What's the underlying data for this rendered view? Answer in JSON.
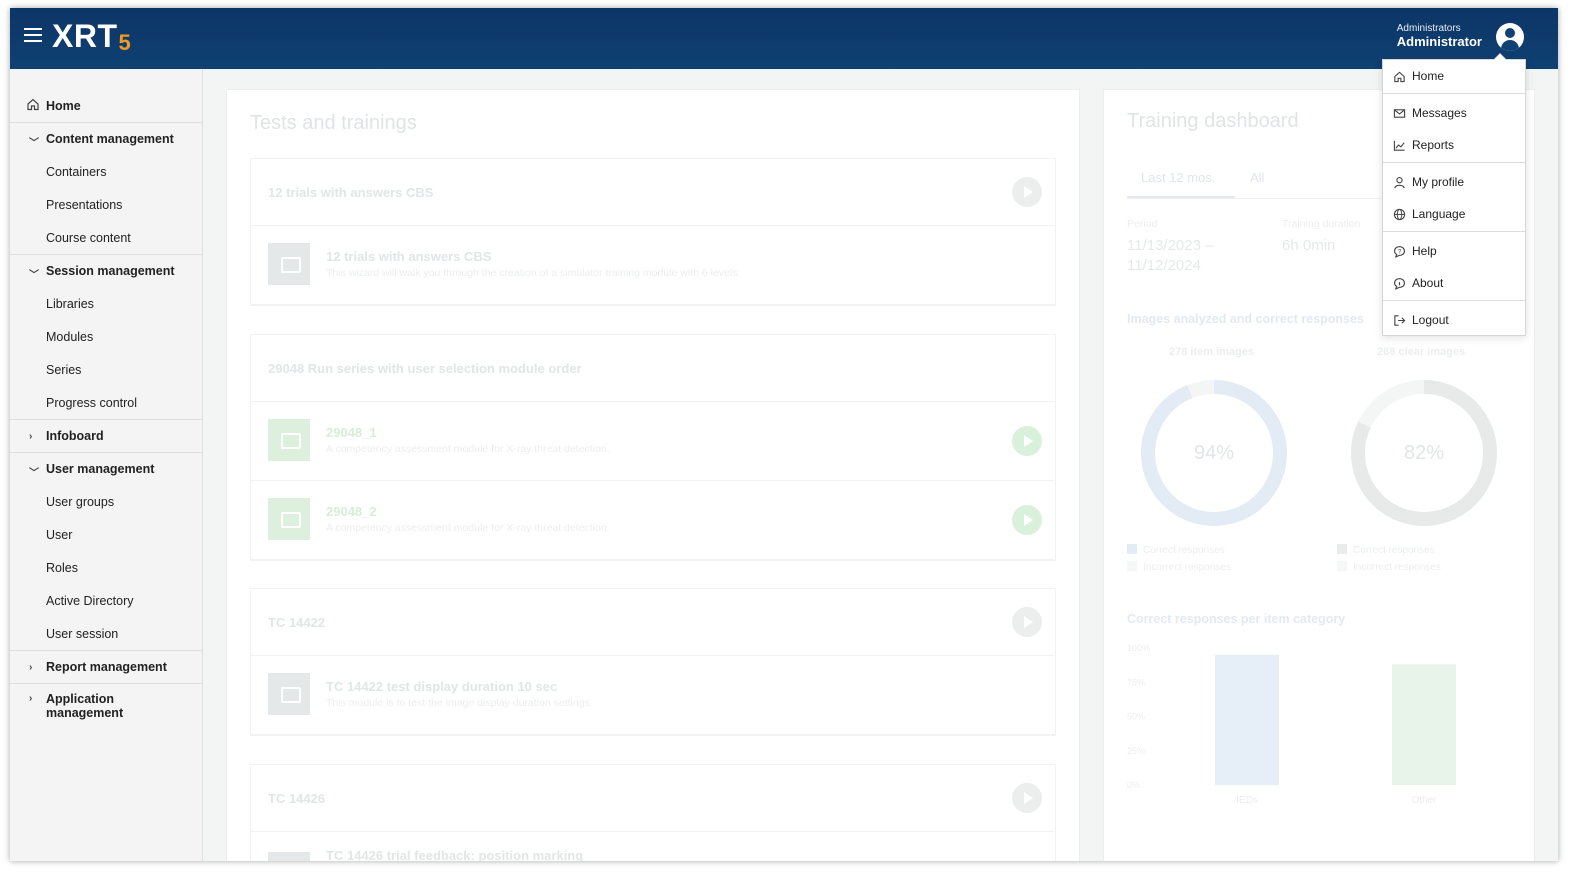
{
  "app": {
    "logo_main": "XRT",
    "logo_suffix": "5"
  },
  "header": {
    "user_role": "Administrators",
    "user_name": "Administrator"
  },
  "sidebar": {
    "items": [
      {
        "label": "Home"
      },
      {
        "label": "Content management"
      },
      {
        "label": "Containers"
      },
      {
        "label": "Presentations"
      },
      {
        "label": "Course content"
      },
      {
        "label": "Session management"
      },
      {
        "label": "Libraries"
      },
      {
        "label": "Modules"
      },
      {
        "label": "Series"
      },
      {
        "label": "Progress control"
      },
      {
        "label": "Infoboard"
      },
      {
        "label": "User management"
      },
      {
        "label": "User groups"
      },
      {
        "label": "User"
      },
      {
        "label": "Roles"
      },
      {
        "label": "Active Directory"
      },
      {
        "label": "User session"
      },
      {
        "label": "Report management"
      },
      {
        "label": "Application management"
      }
    ]
  },
  "tests": {
    "title": "Tests and trainings",
    "groups": [
      {
        "title": "12 trials with answers CBS",
        "modules": [
          {
            "title": "12 trials with answers CBS",
            "desc": "This wizard will walk you through the creation of a simulator training module with 6 levels."
          }
        ]
      },
      {
        "title": "29048 Run series with user selection module order",
        "modules": [
          {
            "title": "29048_1",
            "desc": "A competency assessment module for X-ray threat detection."
          },
          {
            "title": "29048_2",
            "desc": "A competency assessment module for X-ray threat detection."
          }
        ]
      },
      {
        "title": "TC 14422",
        "modules": [
          {
            "title": "TC 14422 test display duration 10 sec",
            "desc": "This module is to test the image display duration settings."
          }
        ]
      },
      {
        "title": "TC 14426",
        "modules": [
          {
            "title": "TC 14426 trial feedback: position marking",
            "desc": ""
          }
        ]
      }
    ]
  },
  "dashboard": {
    "title": "Training dashboard",
    "tabs": [
      "Last 12 mos.",
      "All"
    ],
    "period_label": "Period",
    "period_value_line1": "11/13/2023 –",
    "period_value_line2": "11/12/2024",
    "duration_label": "Training duration",
    "duration_value": "6h 0min",
    "images_title": "Images analyzed and correct responses",
    "donut_left_label": "278 item images",
    "donut_left_pct": "94%",
    "donut_right_label": "268 clear images",
    "donut_right_pct": "82%",
    "legend_correct": "Correct responses",
    "legend_incorrect": "Incorrect responses",
    "category_title": "Correct responses per item category",
    "colors": {
      "left_donut": "#e3ecf5",
      "right_donut": "#e8eaea",
      "bar_ieds": "#e6eef7",
      "bar_other": "#e8f4ea"
    }
  },
  "chart_data": [
    {
      "type": "pie",
      "title": "278 item images",
      "series": [
        {
          "name": "Correct responses",
          "values": [
            94
          ]
        },
        {
          "name": "Incorrect responses",
          "values": [
            6
          ]
        }
      ]
    },
    {
      "type": "pie",
      "title": "268 clear images",
      "series": [
        {
          "name": "Correct responses",
          "values": [
            82
          ]
        },
        {
          "name": "Incorrect responses",
          "values": [
            18
          ]
        }
      ]
    },
    {
      "type": "bar",
      "title": "Correct responses per item category",
      "categories": [
        "IEDs",
        "Other"
      ],
      "values": [
        95,
        88
      ],
      "ylim": [
        0,
        100
      ],
      "yticks": [
        "100%",
        "75%",
        "50%",
        "25%",
        "0%"
      ]
    }
  ],
  "profile_menu": {
    "items": [
      {
        "label": "Home",
        "icon": "home-icon"
      },
      {
        "label": "Messages",
        "icon": "envelope-icon"
      },
      {
        "label": "Reports",
        "icon": "chart-icon"
      },
      {
        "label": "My profile",
        "icon": "user-icon"
      },
      {
        "label": "Language",
        "icon": "globe-icon"
      },
      {
        "label": "Help",
        "icon": "help-icon"
      },
      {
        "label": "About",
        "icon": "info-icon"
      },
      {
        "label": "Logout",
        "icon": "logout-icon"
      }
    ]
  }
}
